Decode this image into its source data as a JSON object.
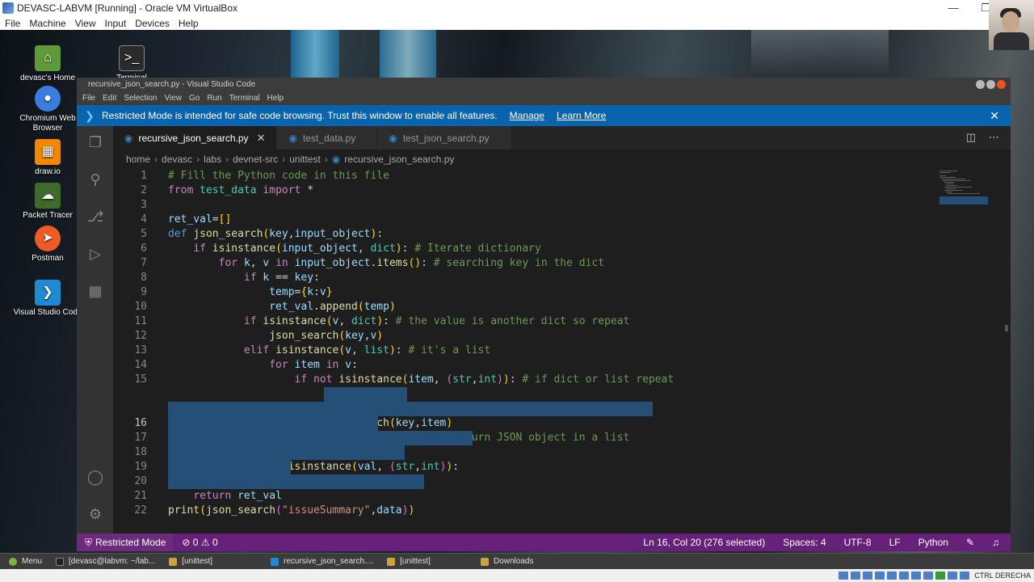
{
  "vbox": {
    "title": "DEVASC-LABVM [Running] - Oracle VM VirtualBox",
    "menu": [
      "File",
      "Machine",
      "View",
      "Input",
      "Devices",
      "Help"
    ],
    "host_key": "CTRL DERECHA"
  },
  "desktop": {
    "icons": [
      {
        "label": "devasc's Home",
        "icon": "folder-icon",
        "color": "#5f9a3a"
      },
      {
        "label": "Terminal",
        "icon": "terminal-icon",
        "color": "#2b2b2b"
      },
      {
        "label": "Chromium Web Browser",
        "icon": "chromium-icon",
        "color": "#3b7ddd"
      },
      {
        "label": "draw.io",
        "icon": "drawio-icon",
        "color": "#f08705"
      },
      {
        "label": "Packet Tracer",
        "icon": "packet-tracer-icon",
        "color": "#3d6b2b"
      },
      {
        "label": "Postman",
        "icon": "postman-icon",
        "color": "#ef5b25"
      },
      {
        "label": "Visual Studio Code",
        "icon": "vscode-icon",
        "color": "#1f8ad2"
      }
    ]
  },
  "vscode": {
    "title": "recursive_json_search.py - Visual Studio Code",
    "menu": [
      "File",
      "Edit",
      "Selection",
      "View",
      "Go",
      "Run",
      "Terminal",
      "Help"
    ],
    "banner": {
      "text": "Restricted Mode is intended for safe code browsing. Trust this window to enable all features.",
      "manage": "Manage",
      "learn_more": "Learn More"
    },
    "tabs": [
      {
        "label": "recursive_json_search.py",
        "active": true
      },
      {
        "label": "test_data.py",
        "active": false
      },
      {
        "label": "test_json_search.py",
        "active": false
      }
    ],
    "breadcrumb": [
      "home",
      "devasc",
      "labs",
      "devnet-src",
      "unittest",
      "recursive_json_search.py"
    ],
    "line_numbers": [
      "1",
      "2",
      "3",
      "4",
      "5",
      "6",
      "7",
      "8",
      "9",
      "10",
      "11",
      "12",
      "13",
      "14",
      "15",
      "16",
      "17",
      "18",
      "19",
      "20",
      "21",
      "22"
    ],
    "status": {
      "restricted": "Restricted Mode",
      "errors": "0",
      "warnings": "0",
      "position": "Ln 16, Col 20 (276 selected)",
      "spaces": "Spaces: 4",
      "encoding": "UTF-8",
      "eol": "LF",
      "language": "Python"
    }
  },
  "taskbar": {
    "menu": "Menu",
    "items": [
      {
        "label": "[devasc@labvm: ~/lab...",
        "icon": "terminal-icon"
      },
      {
        "label": "[unittest]",
        "icon": "folder-icon"
      },
      {
        "label": "recursive_json_search....",
        "icon": "vscode-icon"
      },
      {
        "label": "[unittest]",
        "icon": "folder-icon"
      },
      {
        "label": "Downloads",
        "icon": "folder-icon"
      }
    ]
  }
}
